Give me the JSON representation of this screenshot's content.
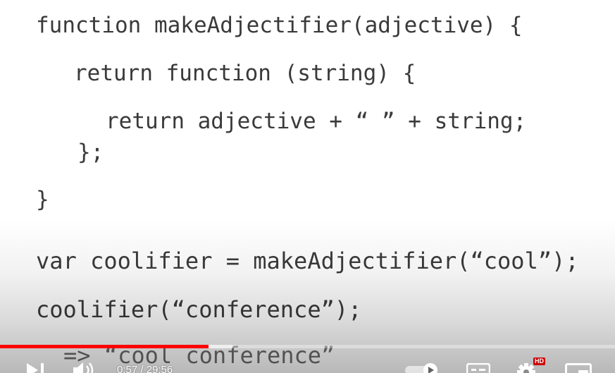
{
  "slide": {
    "code_lines": [
      "function makeAdjectifier(adjective) {",
      "return function (string) {",
      "return adjective + “ ” + string;",
      "};",
      "}",
      "var coolifier = makeAdjectifier(“cool”);",
      "coolifier(“conference”);",
      "=> “cool conference”"
    ]
  },
  "player": {
    "time_display": "0:57 / 29:56",
    "progress_fraction": 0.0317,
    "quality_badge": "HD",
    "accent_color": "#ff0000",
    "icons": {
      "next": "next-icon",
      "volume": "volume-icon",
      "autoplay": "autoplay-toggle-icon",
      "subtitles": "subtitles-icon",
      "settings": "gear-icon",
      "miniplayer": "miniplayer-icon"
    }
  }
}
